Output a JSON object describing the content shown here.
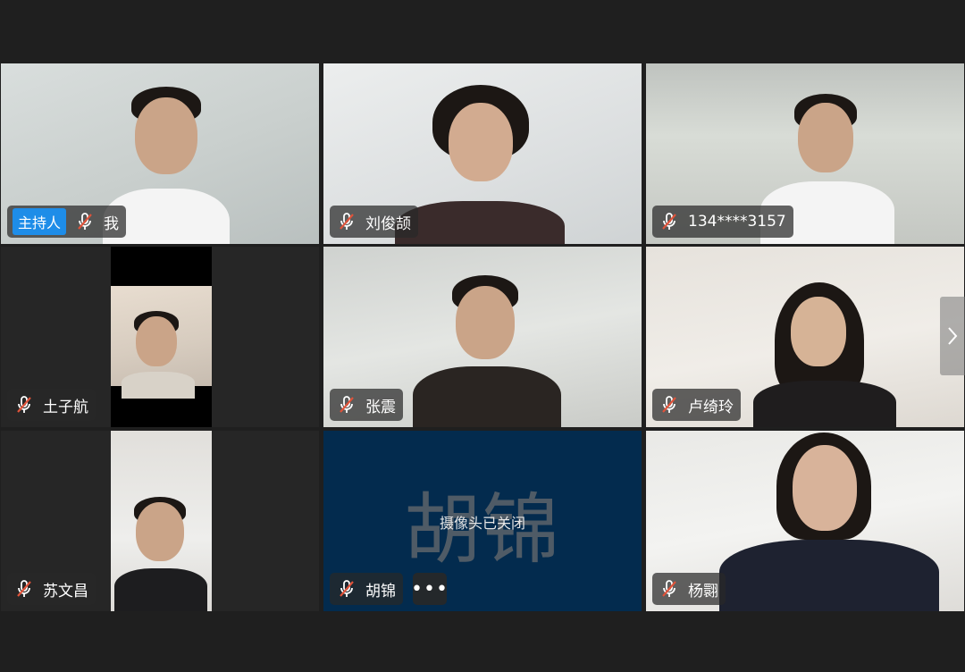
{
  "meeting": {
    "next_page_icon": "chevron-right-icon",
    "mic_icon": "mic-muted-icon",
    "colors": {
      "background": "#1f1f1f",
      "host_badge": "#1e8de8",
      "camera_off_tile": "#032b4e",
      "mute_slash": "#e0533a"
    }
  },
  "participants": [
    {
      "name": "我",
      "host_badge": "主持人",
      "muted": true
    },
    {
      "name": "刘俊颉",
      "muted": true
    },
    {
      "name": "134****3157",
      "muted": true
    },
    {
      "name": "土子航",
      "muted": true
    },
    {
      "name": "张震",
      "muted": true
    },
    {
      "name": "卢绮玲",
      "muted": true
    },
    {
      "name": "苏文昌",
      "muted": true
    },
    {
      "name": "胡锦",
      "muted": true,
      "camera_off": true,
      "big_name": "胡锦",
      "camera_off_text": "摄像头已关闭",
      "more_label": "•••"
    },
    {
      "name": "杨翾",
      "muted": true
    }
  ]
}
